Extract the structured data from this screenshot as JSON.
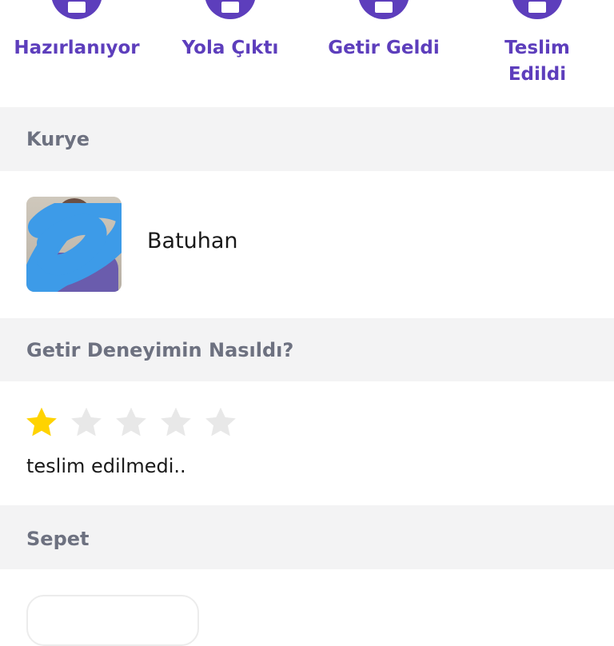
{
  "steps": [
    {
      "label": "Hazırlanıyor",
      "icon": "preparing-bag-icon"
    },
    {
      "label": "Yola Çıktı",
      "icon": "courier-scooter-icon"
    },
    {
      "label": "Getir Geldi",
      "icon": "location-pin-icon"
    },
    {
      "label": "Teslim\nEdildi",
      "icon": "delivered-box-icon"
    }
  ],
  "sections": {
    "courier": "Kurye",
    "experience": "Getir Deneyimin Nasıldı?",
    "basket": "Sepet"
  },
  "courier": {
    "name": "Batuhan",
    "avatar_icon": "courier-avatar"
  },
  "rating": {
    "value": 1,
    "max": 5,
    "comment": "teslim edilmedi.."
  },
  "colors": {
    "brand": "#5d3ebc",
    "star_filled": "#ffd300",
    "star_empty": "#e8e8e8",
    "section_bg": "#f3f3f4",
    "redaction": "#3d9be8"
  }
}
